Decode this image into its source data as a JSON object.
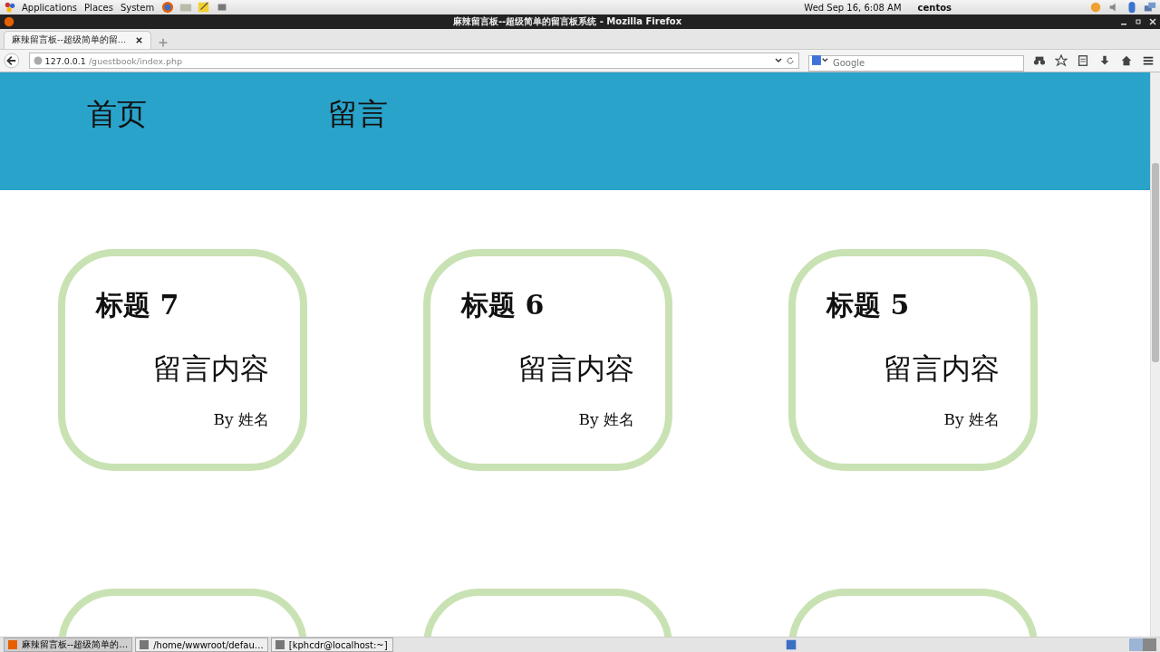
{
  "system_bar": {
    "menus": [
      "Applications",
      "Places",
      "System"
    ],
    "clock": "Wed Sep 16,  6:08 AM",
    "user": "centos"
  },
  "window": {
    "title": "麻辣留言板--超级简单的留言板系统 - Mozilla Firefox"
  },
  "tabs": [
    {
      "label": "麻辣留言板--超级简单的留…",
      "selected": true
    }
  ],
  "address_bar": {
    "host": "127.0.0.1",
    "path": "/guestbook/index.php"
  },
  "search": {
    "placeholder": "Google"
  },
  "page": {
    "nav": [
      "首页",
      "留言"
    ],
    "cards": [
      {
        "kind": "full",
        "title": "标题 7",
        "content": "留言内容",
        "author": "By 姓名"
      },
      {
        "kind": "full",
        "title": "标题 6",
        "content": "留言内容",
        "author": "By 姓名"
      },
      {
        "kind": "full",
        "title": "标题 5",
        "content": "留言内容",
        "author": "By 姓名"
      },
      {
        "kind": "cut"
      },
      {
        "kind": "cut"
      },
      {
        "kind": "cut"
      }
    ]
  },
  "taskbar": {
    "items": [
      {
        "label": "麻辣留言板--超级简单的…",
        "selected": true
      },
      {
        "label": "/home/wwwroot/defau…",
        "selected": false
      },
      {
        "label": "[kphcdr@localhost:~]",
        "selected": false
      }
    ]
  }
}
